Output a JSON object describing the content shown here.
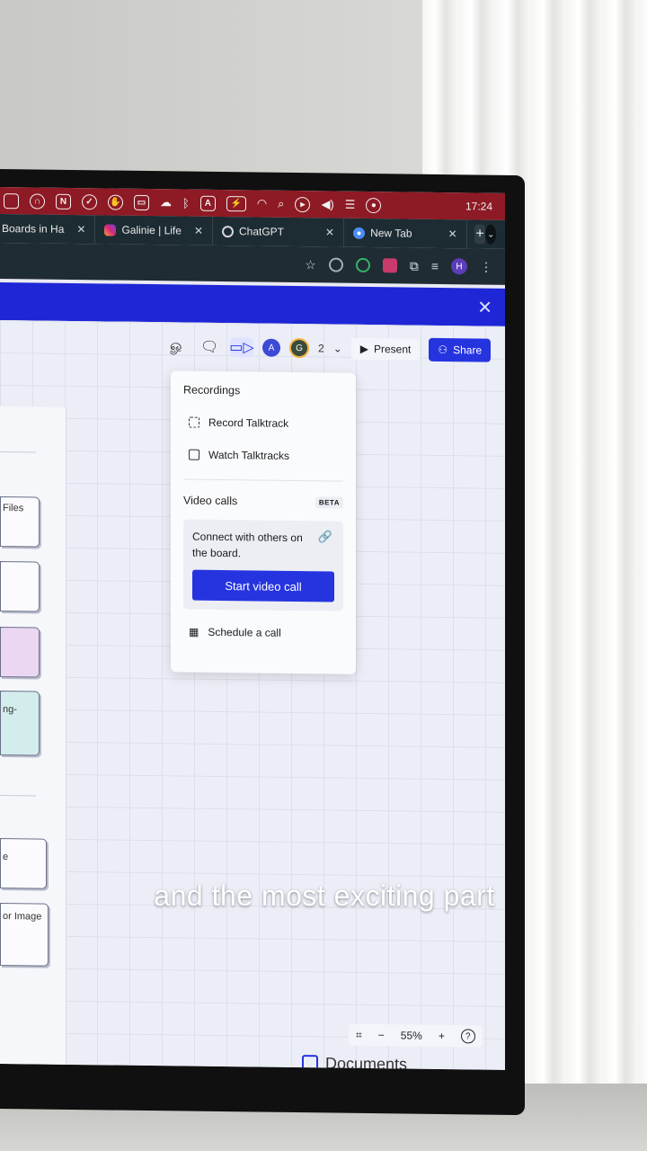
{
  "menubar": {
    "icons": [
      "window-icon",
      "headphones-icon",
      "notion-icon",
      "klack-icon",
      "hand-icon",
      "display-icon",
      "cloud-icon",
      "bluetooth-icon",
      "input-source-icon",
      "battery-icon",
      "wifi-icon",
      "search-icon",
      "play-icon",
      "volume-icon",
      "control-center-icon",
      "siri-icon"
    ],
    "input_letter": "A",
    "notion_letter": "N",
    "clock": "17:24"
  },
  "tabs": [
    {
      "label": "Boards in Ha",
      "icon": "none",
      "close": "✕"
    },
    {
      "label": "Galinie | Life",
      "icon": "instagram-icon",
      "close": "✕"
    },
    {
      "label": "ChatGPT",
      "icon": "chatgpt-icon",
      "close": "✕"
    },
    {
      "label": "New Tab",
      "icon": "chrome-icon",
      "close": "✕"
    }
  ],
  "new_tab_label": "+",
  "tab_dropdown": "⌄",
  "toolbar": {
    "star": "☆",
    "avatar_letter": "H",
    "menu": "⋮"
  },
  "appbar": {
    "close": "✕"
  },
  "board": {
    "avatar_a": "A",
    "avatar_g": "G",
    "collaborator_count": "2",
    "chevron": "⌄",
    "present_label": "Present",
    "present_icon": "▶",
    "share_label": "Share",
    "share_icon": "👤"
  },
  "leftpanel": {
    "cards": [
      "Files",
      "",
      "",
      "ng-",
      "e",
      "or Image"
    ]
  },
  "dropdown": {
    "recordings_heading": "Recordings",
    "record_label": "Record Talktrack",
    "watch_label": "Watch Talktracks",
    "video_calls_heading": "Video calls",
    "beta_badge": "BETA",
    "connect_text": "Connect with others on the board.",
    "start_label": "Start video call",
    "schedule_label": "Schedule a call"
  },
  "zoom": {
    "minus": "−",
    "level": "55%",
    "plus": "+",
    "help": "?"
  },
  "docs_label": "Documents",
  "caption": "and the most exciting part",
  "colors": {
    "brand_blue": "#2634e0",
    "menubar_red": "#8e1a25",
    "tabstrip": "#1d2c33"
  }
}
